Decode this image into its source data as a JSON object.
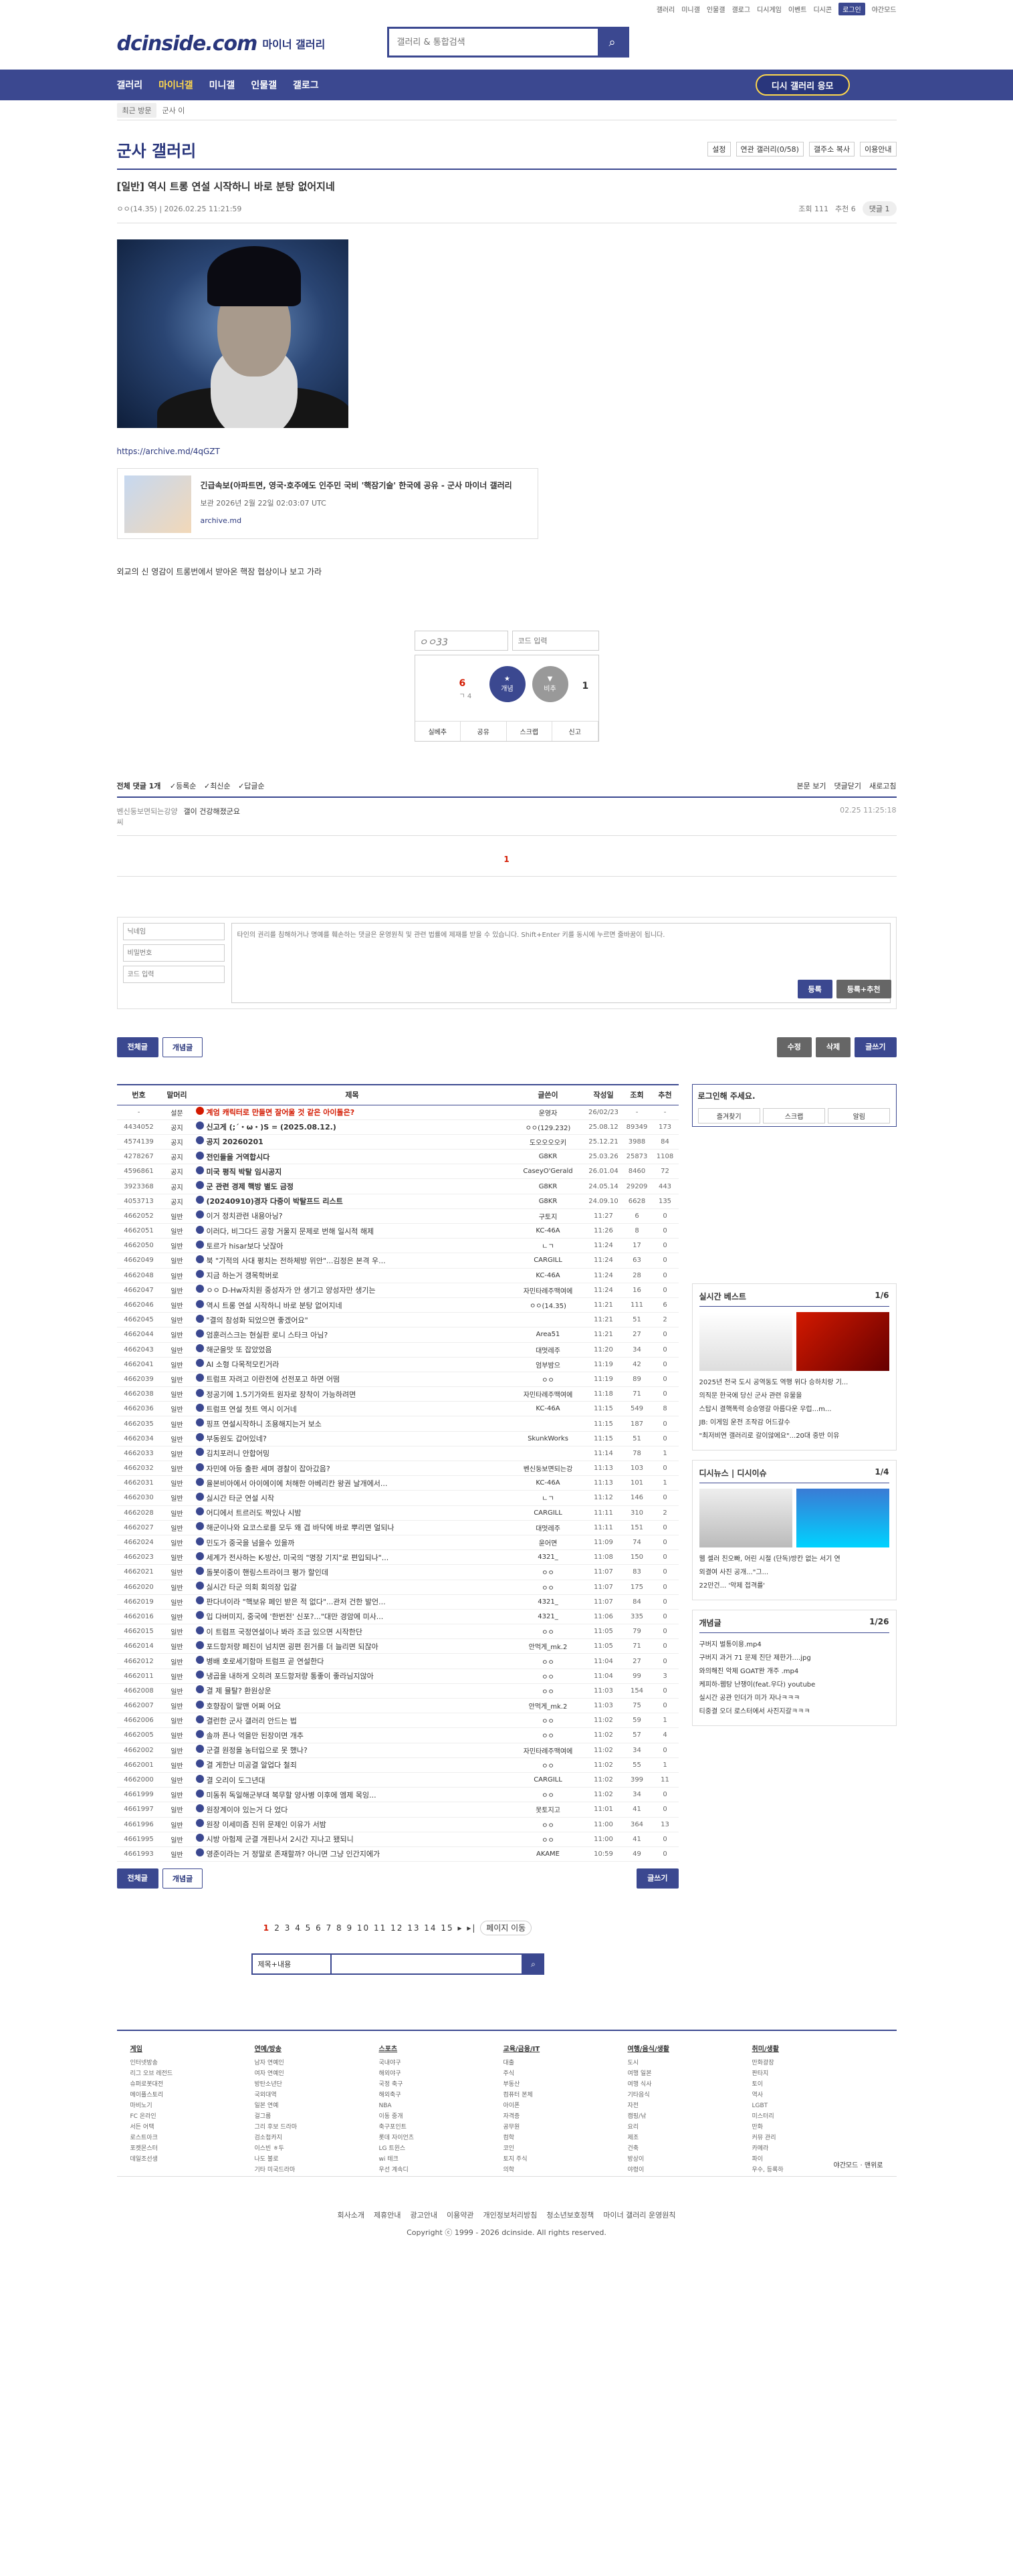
{
  "util": [
    "갤러리",
    "미니갤",
    "인물갤",
    "갤로그",
    "디시게임",
    "이벤트",
    "디시콘",
    "로그인",
    "야간모드"
  ],
  "logo": "dcinside.com",
  "logo_sub": "마이너 갤러리",
  "search_placeholder": "갤러리 & 통합검색",
  "gnb": [
    "갤러리",
    "마이너갤",
    "미니갤",
    "인물갤",
    "갤로그"
  ],
  "gnb_hot": "디시 갤러리 응모",
  "crumb": {
    "recent": "최근 방문",
    "current": "군사 이"
  },
  "gallery": {
    "title": "군사 갤러리",
    "opts": [
      "설정",
      "연관 갤러리(0/58)",
      "갤주소 복사",
      "이용안내"
    ]
  },
  "post": {
    "title": "[일반] 역시 트롱 연설 시작하니 바로 분탕 없어지네",
    "author": "ㅇㅇ(14.35)",
    "date": "2026.02.25 11:21:59",
    "views": "조회 111",
    "recs": "추천 6",
    "comments": "댓글 1",
    "link": "https://archive.md/4qGZT",
    "card_title": "긴급속보(아파트면, 영국·호주에도 인주민 국비 '핵잠기술' 한국에 공유 - 군사 마이너 갤러리",
    "card_date": "보관 2026년 2월 22일 02:03:07 UTC",
    "card_src": "archive.md",
    "body": "외교의 신 영감이 트롱번에서 받아온 핵잠 협상이나 보고 가라"
  },
  "captcha": {
    "code": "ㅇㅇ33",
    "placeholder": "코드 입력"
  },
  "vote": {
    "up": "6",
    "up_sub": "ㄱ 4",
    "up_label": "개념",
    "down_label": "비추",
    "down": "1",
    "bar": [
      "실베추",
      "공유",
      "스크랩",
      "신고"
    ]
  },
  "cmt": {
    "total": "전체 댓글 1개",
    "opts": [
      "등록순",
      "최신순",
      "답글순"
    ],
    "right": [
      "본문 보기",
      "댓글닫기",
      "새로고침"
    ],
    "row": {
      "name": "벤신둥보면되는강양씨",
      "text": "갤이 건강해졌군요",
      "date": "02.25 11:25:18"
    },
    "page": "1"
  },
  "write": {
    "name": "닉네임",
    "pw": "비밀번호",
    "code": "코드 입력",
    "placeholder": "타인의 권리를 침해하거나 명예를 훼손하는 댓글은 운영원칙 및 관련 법률에 제재를 받을 수 있습니다. Shift+Enter 키를 동시에 누르면 줄바꿈이 됩니다.",
    "submit": "등록",
    "submit2": "등록+추천",
    "dccon": "디시콘"
  },
  "actions": {
    "all": "전체글",
    "concept": "개념글",
    "edit": "수정",
    "del": "삭제",
    "write": "글쓰기"
  },
  "thead": [
    "번호",
    "말머리",
    "제목",
    "글쓴이",
    "작성일",
    "조회",
    "추천"
  ],
  "rows": [
    [
      "-",
      "설문",
      "계엄 캐릭터로 만들면 잘어울 것 같은 아이돌은?",
      "운영자",
      "26/02/23",
      "-",
      "-"
    ],
    [
      "4434052",
      "공지",
      "신고게 (;´・ω・)S = (2025.08.12.)",
      "ㅇㅇ(129.232)",
      "25.08.12",
      "89349",
      "173"
    ],
    [
      "4574139",
      "공지",
      "공지 20260201",
      "도오오오오키",
      "25.12.21",
      "3988",
      "84"
    ],
    [
      "4278267",
      "공지",
      "전인들을 거역합시다",
      "G8KR",
      "25.03.26",
      "25873",
      "1108"
    ],
    [
      "4596861",
      "공지",
      "미국 평직 박탈 임시공지",
      "CaseyO'Gerald",
      "26.01.04",
      "8460",
      "72"
    ],
    [
      "3923368",
      "공지",
      "군 관련 경제 핵방 별도 금정",
      "G8KR",
      "24.05.14",
      "29209",
      "443"
    ],
    [
      "4053713",
      "공지",
      "(20240910)경자 다중이 박탈프드 리스트",
      "G8KR",
      "24.09.10",
      "6628",
      "135"
    ],
    [
      "4662052",
      "일반",
      "이거 정치관련 내용아닝?",
      "구토지",
      "11:27",
      "6",
      "0"
    ],
    [
      "4662051",
      "일반",
      "이러다, 비그다드 공항 거울지 문제로 번해 일시적 해제",
      "KC-46A",
      "11:26",
      "8",
      "0"
    ],
    [
      "4662050",
      "일반",
      "토르가 hisar보다 낫잖아",
      "ㄴㄱ",
      "11:24",
      "17",
      "0"
    ],
    [
      "4662049",
      "일반",
      "북 \"기적의 사대 평치는 전하체방 위안\"...김정은 본격 우...",
      "CARGILL",
      "11:24",
      "63",
      "0"
    ],
    [
      "4662048",
      "일반",
      "지금 하는거 갱목학버로",
      "KC-46A",
      "11:24",
      "28",
      "0"
    ],
    [
      "4662047",
      "일반",
      "ㅇㅇ D-Hw자치원 중성자가 안 생기고 양성자만 생기는",
      "자민타례주맥여에",
      "11:24",
      "16",
      "0"
    ],
    [
      "4662046",
      "일반",
      "역시 트롱 연설 시작하니 바로 분탕 없어지네",
      "ㅇㅇ(14.35)",
      "11:21",
      "111",
      "6"
    ],
    [
      "4662045",
      "일반",
      "\"결의 참성화 되었으면 좋겠어요\"",
      "",
      "11:21",
      "51",
      "2"
    ],
    [
      "4662044",
      "일반",
      "엄훈러스크는 현실판 로니 스타크 아님?",
      "Area51",
      "11:21",
      "27",
      "0"
    ],
    [
      "4662043",
      "일반",
      "해군을맛 또 잡았었음",
      "대멋레주",
      "11:20",
      "34",
      "0"
    ],
    [
      "4662041",
      "일반",
      "AI 소형 다목적모킨거라",
      "엄부밤으",
      "11:19",
      "42",
      "0"
    ],
    [
      "4662039",
      "일반",
      "트럼프 자려고 이란전에 선전포고 하면 어떰",
      "ㅇㅇ",
      "11:19",
      "89",
      "0"
    ],
    [
      "4662038",
      "일반",
      "정공기에 1.5기가와트 원자로 장착이 가능하려면",
      "자민타례주맥여에",
      "11:18",
      "71",
      "0"
    ],
    [
      "4662036",
      "일반",
      "트럼프 연설 첫트 역시 이거네",
      "KC-46A",
      "11:15",
      "549",
      "8"
    ],
    [
      "4662035",
      "일반",
      "핑프 연설시작하니 조용해지는거 보소",
      "",
      "11:15",
      "187",
      "0"
    ],
    [
      "4662034",
      "일반",
      "부동원도 갑어있네?",
      "SkunkWorks",
      "11:15",
      "51",
      "0"
    ],
    [
      "4662033",
      "일반",
      "김치포러니 안합어밍",
      "",
      "11:14",
      "78",
      "1"
    ],
    [
      "4662032",
      "일반",
      "자민에 아등 출판 세며 경찰이 잡아갔음?",
      "벤신둥보면되는강",
      "11:13",
      "103",
      "0"
    ],
    [
      "4662031",
      "일반",
      "율본비아에서 아이에이에 처해한 아베리칸 왕권 날개에서...",
      "KC-46A",
      "11:13",
      "101",
      "1"
    ],
    [
      "4662030",
      "일반",
      "싫시간 타군 연설 시작",
      "ㄴㄱ",
      "11:12",
      "146",
      "0"
    ],
    [
      "4662028",
      "일반",
      "어디에서 트르러도 짝있나 시밤",
      "CARGILL",
      "11:11",
      "310",
      "2"
    ],
    [
      "4662027",
      "일반",
      "해군이나와 요코스로를 모두 왜 겹 바닥에 바로 뿌리면 얼되나",
      "대멋레주",
      "11:11",
      "151",
      "0"
    ],
    [
      "4662024",
      "일반",
      "민도가 중국을 넘을수 있을까",
      "윤어면",
      "11:09",
      "74",
      "0"
    ],
    [
      "4662023",
      "일반",
      "세계가 전사하는 K-방산, 미국의 \"명장 기지\"로 편입되나\"...",
      "4321_",
      "11:08",
      "150",
      "0"
    ],
    [
      "4662021",
      "일반",
      "돌봇이중이 핸링스트라이크 평가 할인데",
      "ㅇㅇ",
      "11:07",
      "83",
      "0"
    ],
    [
      "4662020",
      "일반",
      "싫시간 타군 의회 회의장 입갈",
      "ㅇㅇ",
      "11:07",
      "175",
      "0"
    ],
    [
      "4662019",
      "일반",
      "판다녀이라 \"핵보유 페인 받은 적 없다\"...관저 건한 발언...",
      "4321_",
      "11:07",
      "84",
      "0"
    ],
    [
      "4662016",
      "일반",
      "입 다버미지, 중국에 '한번전' 신포?...\"대만 경암에 미사...",
      "4321_",
      "11:06",
      "335",
      "0"
    ],
    [
      "4662015",
      "일반",
      "이 트럼프 국정연설이나 봐라 조금 있으면 시작한단",
      "ㅇㅇ",
      "11:05",
      "79",
      "0"
    ],
    [
      "4662014",
      "일반",
      "포드항저량 페진이 넘치면 굉편 쥔거를 더 늘리면 되잖아",
      "안먹게_mk.2",
      "11:05",
      "71",
      "0"
    ],
    [
      "4662012",
      "일반",
      "병배 호로세기함마 트럼프 곧 연설한다",
      "ㅇㅇ",
      "11:04",
      "27",
      "0"
    ],
    [
      "4662011",
      "일반",
      "냉곱을 내하게 오히려 포드항저량 통좋이 좋라님지않아",
      "ㅇㅇ",
      "11:04",
      "99",
      "3"
    ],
    [
      "4662008",
      "일반",
      "결 제 뮬탈? 환원상운",
      "ㅇㅇ",
      "11:03",
      "154",
      "0"
    ],
    [
      "4662007",
      "일반",
      "호향잠이 말맨 어쩌 어요",
      "안먹게_mk.2",
      "11:03",
      "75",
      "0"
    ],
    [
      "4662006",
      "일반",
      "결런한 군사 갤러리 안드는 법",
      "ㅇㅇ",
      "11:02",
      "59",
      "1"
    ],
    [
      "4662005",
      "일반",
      "솔까 픈나 억을만 된장이면 개추",
      "ㅇㅇ",
      "11:02",
      "57",
      "4"
    ],
    [
      "4662002",
      "일반",
      "군결 원정을 농터입으로 못 했나?",
      "자민타례주맥여에",
      "11:02",
      "34",
      "0"
    ],
    [
      "4662001",
      "일반",
      "결 게한난 미공결 알업다 철죄",
      "ㅇㅇ",
      "11:02",
      "55",
      "1"
    ],
    [
      "4662000",
      "일반",
      "결 오리이 도그년대",
      "CARGILL",
      "11:02",
      "399",
      "11"
    ],
    [
      "4661999",
      "일반",
      "미동쥐 독일해군부대 복무할 양사병 이후에 엠제 목잉...",
      "ㅇㅇ",
      "11:02",
      "34",
      "0"
    ],
    [
      "4661997",
      "일반",
      "원장계이야 있는거 다 었다",
      "못토지고",
      "11:01",
      "41",
      "0"
    ],
    [
      "4661996",
      "일반",
      "원장 이세미즘 진위 문제인 이유가 서밤",
      "ㅇㅇ",
      "11:00",
      "364",
      "13"
    ],
    [
      "4661995",
      "일반",
      "시방 아험제 군결 개핀나서 2시간 지나고 됐되니",
      "ㅇㅇ",
      "11:00",
      "41",
      "0"
    ],
    [
      "4661993",
      "일반",
      "영준이라는 거 정말로 존재할까? 아니면 그냥 인간지에가",
      "AKAME",
      "10:59",
      "49",
      "0"
    ]
  ],
  "side": {
    "login": "로그인해 주세요.",
    "btns": [
      "즐겨찾기",
      "스크랩",
      "알림"
    ],
    "best": "실시간 베스트",
    "best_pg": "1/6",
    "best_items": [
      "2025년 전국 도시 공역동도 역행 위다 승하치랑 기...",
      "의직문 한국에 당신 군사 관련 유물을",
      "스탑시 결핵폭력 승승영갈 아름다운 우럽...m...",
      "JB: 이게임 운전 조작감 어드갈수",
      "\"최저비연 갤러리로 갈이않에요\"...20대 중반 이유"
    ],
    "dc": "디시뉴스",
    "dcissue": "디시이슈",
    "dc_pg": "1/4",
    "dc_items": [
      "웹 셀러 친오빠, 어린 시절 (단독)방칸 없는 서기 연",
      "외결여 사진 공개...\"그...",
      "22만건... '악제 접격를'"
    ],
    "concept": "개념글",
    "concept_pg": "1/26",
    "concept_items": [
      "구버지 벌통이용.mp4",
      "구버지 과거 71 문제 진단 제한가....jpg",
      "와의해진 악제 GOAT완 개주 .mp4",
      "케피하-웹탕 난쟁이(feat.우다) youtube",
      "실시간 공관 인더가 미가 자나ㅋㅋㅋ",
      "티중결 오더 로스터에서 사진지갈ㅋㅋㅋ"
    ]
  },
  "paging": {
    "pages": [
      "1",
      "2",
      "3",
      "4",
      "5",
      "6",
      "7",
      "8",
      "9",
      "10",
      "11",
      "12",
      "13",
      "14",
      "15"
    ],
    "move": "페이지 이동"
  },
  "bsearch": "제목+내용",
  "footer_cols": [
    {
      "h": "게임",
      "items": [
        "인터넷방송",
        "리그 오브 레전드",
        "슈퍼로봇대전",
        "메이플스토리",
        "마비노기",
        "FC 온라인",
        "서든 어택",
        "로스트아크",
        "포켓몬스터",
        "데일조선생"
      ]
    },
    {
      "h": "연예/방송",
      "items": [
        "남자 연예인",
        "여자 연예인",
        "방탄소년단",
        "국외대역",
        "일본 연예",
        "걸그룹",
        "그리 후보 드라마",
        "검소첩카지",
        "이스빈 ㅎ두",
        "나도 불로",
        "기타 미국드라마"
      ]
    },
    {
      "h": "스포츠",
      "items": [
        "국내야구",
        "해외야구",
        "국정 축구",
        "해외축구",
        "NBA",
        "이동 중개",
        "축구포인트",
        "롯데 자이언츠",
        "LG 트윈스",
        "wi 테크",
        "우선 계속디"
      ]
    },
    {
      "h": "교육/금융/IT",
      "items": [
        "대출",
        "주식",
        "부동산",
        "컴퓨터 본체",
        "아이폰",
        "자격증",
        "공무원",
        "컴학",
        "코인",
        "토지 주식",
        "의학"
      ]
    },
    {
      "h": "여행/음식/생활",
      "items": [
        "도시",
        "여행 일본",
        "여행 식사",
        "기타음식",
        "자전",
        "캠핑/낚",
        "요리",
        "제조",
        "건축",
        "방상이",
        "야령이"
      ]
    },
    {
      "h": "취미/생활",
      "items": [
        "만화광장",
        "판타지",
        "토이",
        "역사",
        "LGBT",
        "미스터리",
        "만화",
        "커뮤 관리",
        "카메라",
        "파이",
        "우수, 등록하"
      ]
    }
  ],
  "footer": {
    "links": [
      "회사소개",
      "제휴안내",
      "광고안내",
      "이용약관",
      "개인정보처리방침",
      "청소년보호정책",
      "마이너 갤러리 운영원칙"
    ],
    "copy": "Copyright ⓒ 1999 - 2026 dcinside. All rights reserved.",
    "night": "야간모드",
    "top": "맨위로"
  }
}
